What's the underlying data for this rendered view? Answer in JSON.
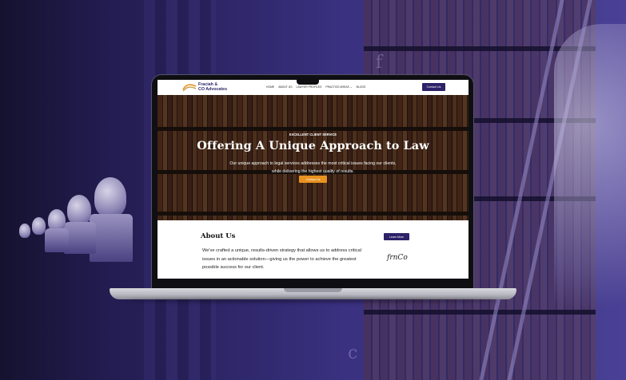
{
  "site": {
    "logo_line1": "Fraciah &",
    "logo_line2": "CO Advocates",
    "nav": [
      "HOME",
      "ABOUT US",
      "LAWYER PROFILES",
      "PRACTICE AREAS ⌄",
      "BLOGS"
    ],
    "nav_button": "Contact Us"
  },
  "hero": {
    "eyebrow": "EXCELLENT CLIENT SERVICE",
    "title": "Offering A Unique Approach to Law",
    "description": "Our unique approach to legal services addresses the most critical issues facing our clients, while delivering the highest quality of results.",
    "button": "Contact Us"
  },
  "about": {
    "title": "About Us",
    "text": "We've crafted a unique, results-driven strategy that allows us to address critical issues in an actionable solution—giving us the power to achieve the greatest possible success for our client.",
    "button": "Learn More",
    "signature": "frnCo"
  },
  "colors": {
    "brand_purple": "#2d2168",
    "accent_orange": "#e8921f",
    "background": "#2b2466"
  }
}
